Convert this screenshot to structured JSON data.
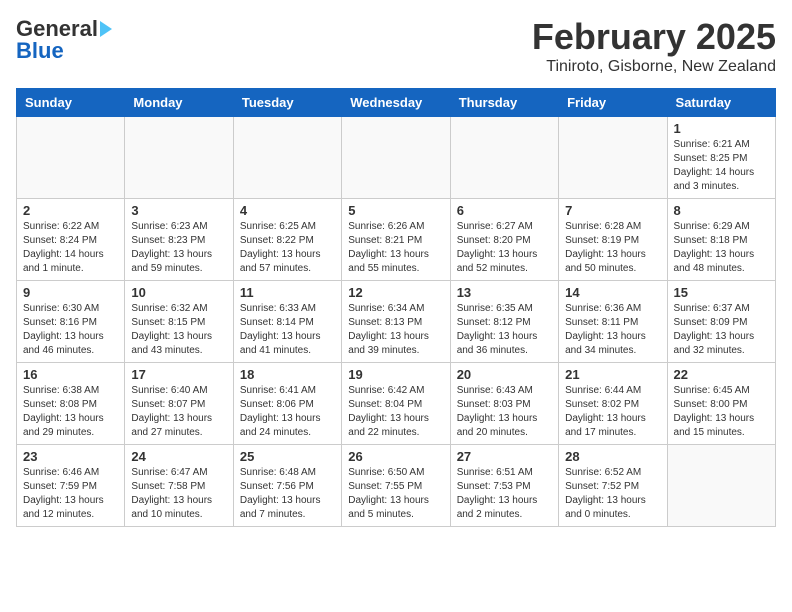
{
  "header": {
    "logo_general": "General",
    "logo_blue": "Blue",
    "title": "February 2025",
    "subtitle": "Tiniroto, Gisborne, New Zealand"
  },
  "weekdays": [
    "Sunday",
    "Monday",
    "Tuesday",
    "Wednesday",
    "Thursday",
    "Friday",
    "Saturday"
  ],
  "weeks": [
    [
      {
        "day": "",
        "info": ""
      },
      {
        "day": "",
        "info": ""
      },
      {
        "day": "",
        "info": ""
      },
      {
        "day": "",
        "info": ""
      },
      {
        "day": "",
        "info": ""
      },
      {
        "day": "",
        "info": ""
      },
      {
        "day": "1",
        "info": "Sunrise: 6:21 AM\nSunset: 8:25 PM\nDaylight: 14 hours\nand 3 minutes."
      }
    ],
    [
      {
        "day": "2",
        "info": "Sunrise: 6:22 AM\nSunset: 8:24 PM\nDaylight: 14 hours\nand 1 minute."
      },
      {
        "day": "3",
        "info": "Sunrise: 6:23 AM\nSunset: 8:23 PM\nDaylight: 13 hours\nand 59 minutes."
      },
      {
        "day": "4",
        "info": "Sunrise: 6:25 AM\nSunset: 8:22 PM\nDaylight: 13 hours\nand 57 minutes."
      },
      {
        "day": "5",
        "info": "Sunrise: 6:26 AM\nSunset: 8:21 PM\nDaylight: 13 hours\nand 55 minutes."
      },
      {
        "day": "6",
        "info": "Sunrise: 6:27 AM\nSunset: 8:20 PM\nDaylight: 13 hours\nand 52 minutes."
      },
      {
        "day": "7",
        "info": "Sunrise: 6:28 AM\nSunset: 8:19 PM\nDaylight: 13 hours\nand 50 minutes."
      },
      {
        "day": "8",
        "info": "Sunrise: 6:29 AM\nSunset: 8:18 PM\nDaylight: 13 hours\nand 48 minutes."
      }
    ],
    [
      {
        "day": "9",
        "info": "Sunrise: 6:30 AM\nSunset: 8:16 PM\nDaylight: 13 hours\nand 46 minutes."
      },
      {
        "day": "10",
        "info": "Sunrise: 6:32 AM\nSunset: 8:15 PM\nDaylight: 13 hours\nand 43 minutes."
      },
      {
        "day": "11",
        "info": "Sunrise: 6:33 AM\nSunset: 8:14 PM\nDaylight: 13 hours\nand 41 minutes."
      },
      {
        "day": "12",
        "info": "Sunrise: 6:34 AM\nSunset: 8:13 PM\nDaylight: 13 hours\nand 39 minutes."
      },
      {
        "day": "13",
        "info": "Sunrise: 6:35 AM\nSunset: 8:12 PM\nDaylight: 13 hours\nand 36 minutes."
      },
      {
        "day": "14",
        "info": "Sunrise: 6:36 AM\nSunset: 8:11 PM\nDaylight: 13 hours\nand 34 minutes."
      },
      {
        "day": "15",
        "info": "Sunrise: 6:37 AM\nSunset: 8:09 PM\nDaylight: 13 hours\nand 32 minutes."
      }
    ],
    [
      {
        "day": "16",
        "info": "Sunrise: 6:38 AM\nSunset: 8:08 PM\nDaylight: 13 hours\nand 29 minutes."
      },
      {
        "day": "17",
        "info": "Sunrise: 6:40 AM\nSunset: 8:07 PM\nDaylight: 13 hours\nand 27 minutes."
      },
      {
        "day": "18",
        "info": "Sunrise: 6:41 AM\nSunset: 8:06 PM\nDaylight: 13 hours\nand 24 minutes."
      },
      {
        "day": "19",
        "info": "Sunrise: 6:42 AM\nSunset: 8:04 PM\nDaylight: 13 hours\nand 22 minutes."
      },
      {
        "day": "20",
        "info": "Sunrise: 6:43 AM\nSunset: 8:03 PM\nDaylight: 13 hours\nand 20 minutes."
      },
      {
        "day": "21",
        "info": "Sunrise: 6:44 AM\nSunset: 8:02 PM\nDaylight: 13 hours\nand 17 minutes."
      },
      {
        "day": "22",
        "info": "Sunrise: 6:45 AM\nSunset: 8:00 PM\nDaylight: 13 hours\nand 15 minutes."
      }
    ],
    [
      {
        "day": "23",
        "info": "Sunrise: 6:46 AM\nSunset: 7:59 PM\nDaylight: 13 hours\nand 12 minutes."
      },
      {
        "day": "24",
        "info": "Sunrise: 6:47 AM\nSunset: 7:58 PM\nDaylight: 13 hours\nand 10 minutes."
      },
      {
        "day": "25",
        "info": "Sunrise: 6:48 AM\nSunset: 7:56 PM\nDaylight: 13 hours\nand 7 minutes."
      },
      {
        "day": "26",
        "info": "Sunrise: 6:50 AM\nSunset: 7:55 PM\nDaylight: 13 hours\nand 5 minutes."
      },
      {
        "day": "27",
        "info": "Sunrise: 6:51 AM\nSunset: 7:53 PM\nDaylight: 13 hours\nand 2 minutes."
      },
      {
        "day": "28",
        "info": "Sunrise: 6:52 AM\nSunset: 7:52 PM\nDaylight: 13 hours\nand 0 minutes."
      },
      {
        "day": "",
        "info": ""
      }
    ]
  ]
}
